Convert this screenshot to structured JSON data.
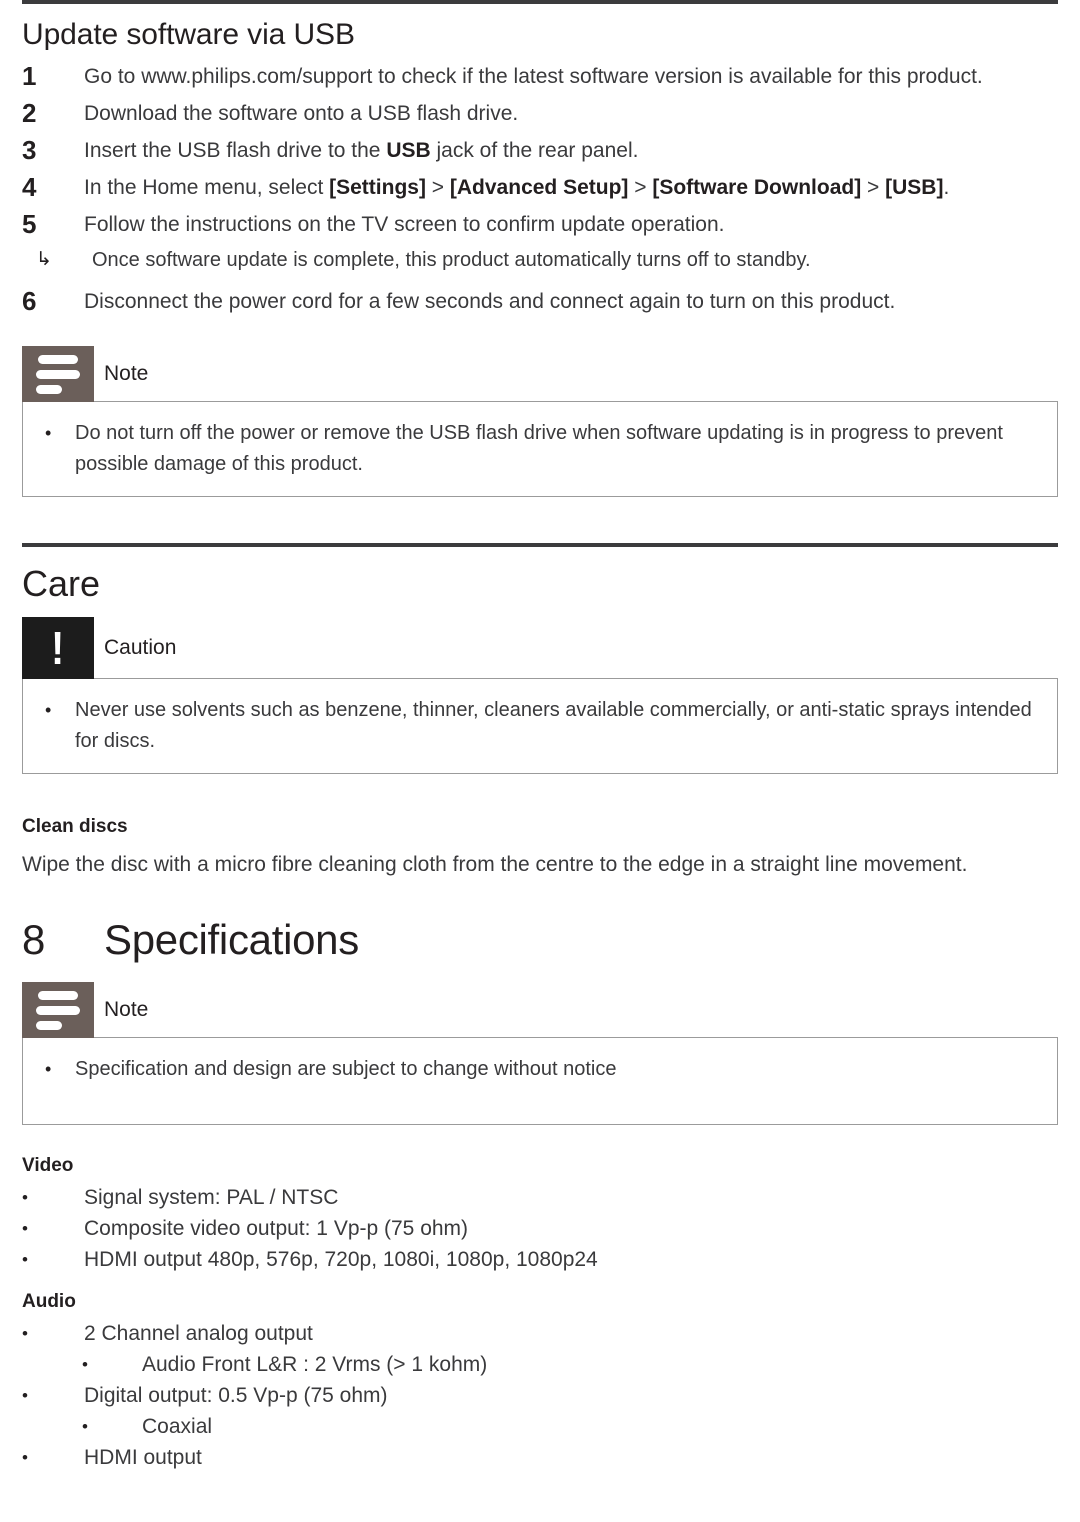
{
  "colors": {
    "rule": "#3b3b3d",
    "note_icon_bg": "#6b5f5a",
    "caution_icon_bg": "#1c1c1c",
    "box_border": "#9b9b9b",
    "text": "#3a3a3c",
    "heading": "#231f20"
  },
  "update_section": {
    "title": "Update software via USB",
    "steps": [
      {
        "num": "1",
        "text": "Go to www.philips.com/support to check if the latest software version is available for this product."
      },
      {
        "num": "2",
        "text": "Download the software onto a USB flash drive."
      },
      {
        "num": "3",
        "text_pre": "Insert the USB flash drive to the ",
        "text_bold": "USB",
        "text_post": " jack of the rear panel."
      },
      {
        "num": "4",
        "text_pre": "In the Home menu, select ",
        "b1": "[Settings]",
        "sep1": " > ",
        "b2": "[Advanced Setup]",
        "sep2": " > ",
        "b3": "[Software Download]",
        "sep3": " > ",
        "b4": "[USB]",
        "text_post": "."
      },
      {
        "num": "5",
        "text": "Follow the instructions on the TV screen to confirm update operation.",
        "substep": {
          "arrow": "↳",
          "text": "Once software update is complete, this product automatically turns off to standby."
        }
      },
      {
        "num": "6",
        "text": "Disconnect the power cord for a few seconds and connect again to turn on this product."
      }
    ],
    "note": {
      "label": "Note",
      "icon": "note-lines-icon",
      "bullet": "•",
      "items": [
        "Do not turn off the power or remove the USB flash drive when software updating is in progress to prevent possible damage of this product."
      ]
    }
  },
  "care_section": {
    "title": "Care",
    "caution": {
      "label": "Caution",
      "icon": "exclamation-icon",
      "glyph": "!",
      "bullet": "•",
      "items": [
        "Never use solvents such as benzene, thinner, cleaners available commercially, or anti-static sprays intended for discs."
      ]
    },
    "clean_discs": {
      "heading": "Clean discs",
      "paragraph": "Wipe the disc with a micro fibre cleaning cloth from the centre to the edge in a straight line movement."
    }
  },
  "specifications_chapter": {
    "number": "8",
    "name": "Specifications",
    "note": {
      "label": "Note",
      "icon": "note-lines-icon",
      "bullet": "•",
      "items": [
        "Specification and design are subject to change without notice"
      ]
    },
    "groups": [
      {
        "heading": "Video",
        "bullet": "•",
        "items": [
          {
            "level": 1,
            "text": "Signal system: PAL / NTSC"
          },
          {
            "level": 1,
            "text": "Composite video output: 1 Vp-p (75 ohm)"
          },
          {
            "level": 1,
            "text": "HDMI output 480p, 576p, 720p, 1080i, 1080p, 1080p24"
          }
        ]
      },
      {
        "heading": "Audio",
        "bullet": "•",
        "items": [
          {
            "level": 1,
            "text": "2 Channel analog output"
          },
          {
            "level": 2,
            "text": "Audio Front L&R : 2 Vrms (> 1 kohm)"
          },
          {
            "level": 1,
            "text": "Digital output: 0.5 Vp-p (75 ohm)"
          },
          {
            "level": 2,
            "text": "Coaxial"
          },
          {
            "level": 1,
            "text": "HDMI output"
          }
        ]
      }
    ]
  }
}
